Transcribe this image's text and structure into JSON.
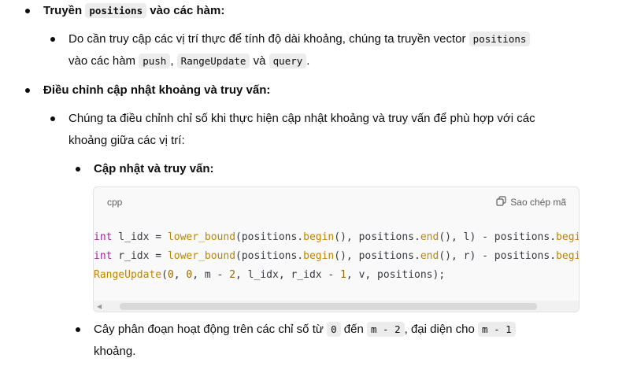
{
  "section1": {
    "title_prefix": "Truyền",
    "title_code": "positions",
    "title_suffix": "vào các hàm:",
    "item1": {
      "text1": "Do cần truy cập các vị trí thực để tính độ dài khoảng, chúng ta truyền vector",
      "code1": "positions",
      "text2": "vào các hàm",
      "code2": "push",
      "sep1": ",",
      "code3": "RangeUpdate",
      "text3": "và",
      "code4": "query",
      "end": "."
    }
  },
  "section2": {
    "title": "Điều chỉnh cập nhật khoảng và truy vấn:",
    "item1": {
      "line1": "Chúng ta điều chỉnh chỉ số khi thực hiện cập nhật khoảng và truy vấn để phù hợp với các",
      "line2": "khoảng giữa các vị trí:"
    },
    "subitem1": {
      "title": "Cập nhật và truy vấn:"
    },
    "codeblock": {
      "language": "cpp",
      "copy_label": "Sao chép mã",
      "copy_icon": "copy-icon"
    },
    "subitem2": {
      "text1": "Cây phân đoạn hoạt động trên các chỉ số từ",
      "code1": "0",
      "text2": "đến",
      "code2": "m - 2",
      "text3": ", đại diện cho",
      "code3": "m - 1",
      "line2": "khoảng."
    }
  }
}
